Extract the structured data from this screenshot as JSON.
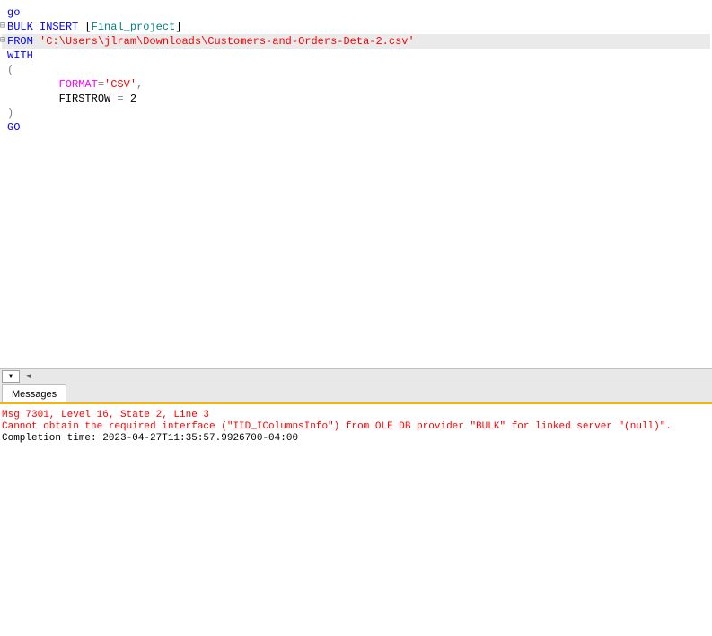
{
  "editor": {
    "lines": {
      "l1_go": "go",
      "l2_bulk": "BULK",
      "l2_insert": "INSERT",
      "l2_bracket_open": "[",
      "l2_table": "Final_project",
      "l2_bracket_close": "]",
      "l3_from": "FROM",
      "l3_path": "'C:\\Users\\jlram\\Downloads\\Customers-and-Orders-Deta-2.csv'",
      "l4_with": "WITH",
      "l5_paren_open": "(",
      "l6_indent": "        ",
      "l6_format": "FORMAT",
      "l6_eq": "=",
      "l6_csv": "'CSV'",
      "l6_comma": ",",
      "l7_indent": "        ",
      "l7_firstrow": "FIRSTROW ",
      "l7_eq": "=",
      "l7_val": " 2",
      "l8_paren_close": ")",
      "l9_go": "GO"
    },
    "outline_markers": {
      "m1": "⊟",
      "m2": "⊟"
    }
  },
  "tabs": {
    "messages": "Messages"
  },
  "messages": {
    "line1": "Msg 7301, Level 16, State 2, Line 3",
    "line2": "Cannot obtain the required interface (\"IID_IColumnsInfo\") from OLE DB provider \"BULK\" for linked server \"(null)\".",
    "blank": "",
    "line3": "Completion time: 2023-04-27T11:35:57.9926700-04:00"
  }
}
